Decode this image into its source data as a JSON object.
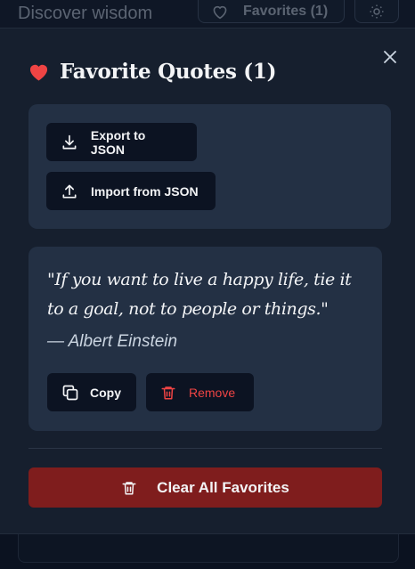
{
  "background": {
    "app_title": "Discover wisdom",
    "favorites_button_label": "Favorites (1)",
    "theme_icon": "sun-icon"
  },
  "modal": {
    "title": "Favorite Quotes (1)",
    "title_icon": "heart-icon",
    "close_icon": "close-icon",
    "export_label": "Export to JSON",
    "import_label": "Import from JSON",
    "favorites": [
      {
        "text": "\"If you want to live a happy life, tie it to a goal, not to people or things.\"",
        "author": "— Albert Einstein",
        "copy_label": "Copy",
        "remove_label": "Remove"
      }
    ],
    "clear_label": "Clear All Favorites"
  },
  "colors": {
    "accent_red": "#ef4444",
    "danger_bg": "#7f1d1d",
    "modal_bg": "#161f2e",
    "card_bg": "#233044"
  }
}
